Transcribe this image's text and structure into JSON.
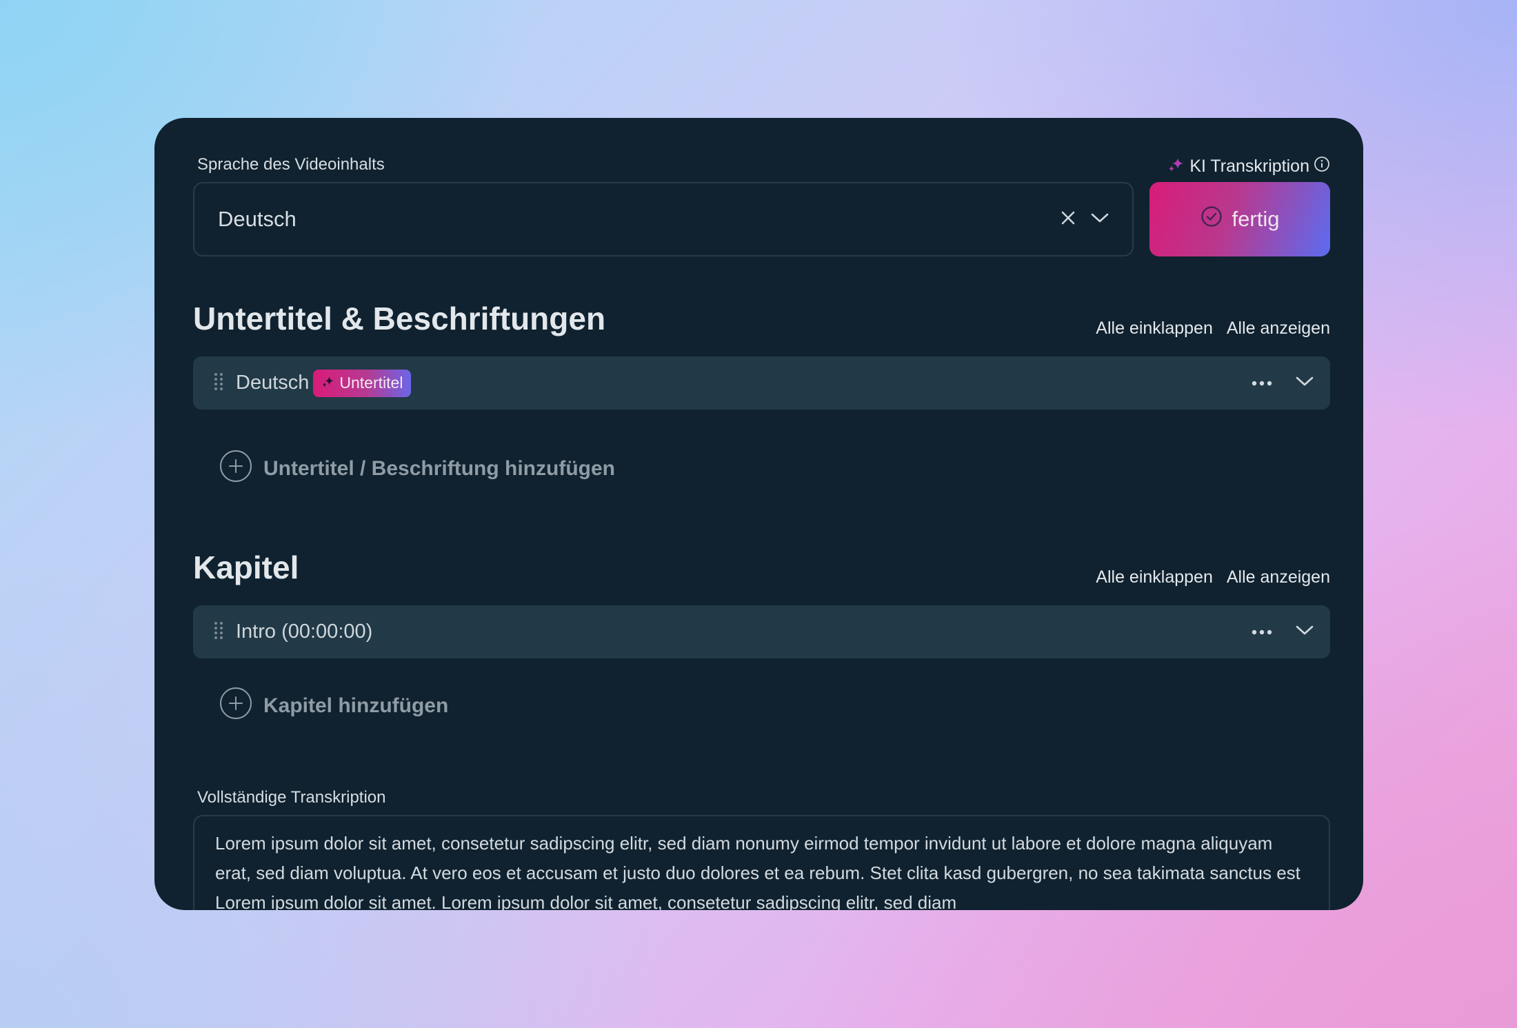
{
  "language": {
    "label": "Sprache des Videoinhalts",
    "value": "Deutsch"
  },
  "ai": {
    "label": "KI Transkription",
    "button_label": "fertig"
  },
  "subtitles": {
    "title": "Untertitel & Beschriftungen",
    "collapse_all": "Alle einklappen",
    "show_all": "Alle anzeigen",
    "items": [
      {
        "name": "Deutsch",
        "badge": "Untertitel"
      }
    ],
    "add_label": "Untertitel / Beschriftung hinzufügen"
  },
  "chapters": {
    "title": "Kapitel",
    "collapse_all": "Alle einklappen",
    "show_all": "Alle anzeigen",
    "items": [
      {
        "name": "Intro (00:00:00)"
      }
    ],
    "add_label": "Kapitel hinzufügen"
  },
  "transcription": {
    "label": "Vollständige Transkription",
    "text": "Lorem ipsum dolor sit amet, consetetur sadipscing elitr, sed diam nonumy eirmod tempor invidunt ut labore et dolore magna aliquyam erat, sed diam voluptua. At vero eos et accusam et justo duo dolores et ea rebum. Stet clita kasd gubergren, no sea takimata sanctus est Lorem ipsum dolor sit amet. Lorem ipsum dolor sit amet, consetetur sadipscing elitr, sed diam"
  },
  "colors": {
    "card_bg": "#10222f",
    "row_bg": "#223947",
    "accent_pink": "#d81c78",
    "accent_blue": "#5b6cf0"
  },
  "icons": [
    "clear-icon",
    "chevron-down-icon",
    "sparkle-icon",
    "info-icon",
    "check-circle-icon",
    "drag-handle-icon",
    "more-icon",
    "plus-circle-icon"
  ]
}
